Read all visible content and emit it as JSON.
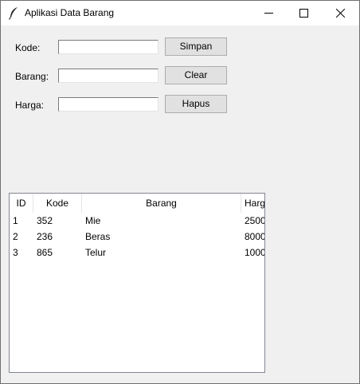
{
  "window": {
    "title": "Aplikasi Data Barang",
    "app_icon": "feather-icon",
    "controls": [
      "minimize-icon",
      "maximize-icon",
      "close-icon"
    ]
  },
  "form": {
    "kode_label": "Kode:",
    "barang_label": "Barang:",
    "harga_label": "Harga:",
    "kode_value": "",
    "barang_value": "",
    "harga_value": ""
  },
  "buttons": {
    "simpan": "Simpan",
    "clear": "Clear",
    "hapus": "Hapus"
  },
  "table": {
    "columns": [
      "ID",
      "Kode",
      "Barang",
      "Harg"
    ],
    "rows": [
      {
        "id": "1",
        "kode": "352",
        "barang": "Mie",
        "harga": "2500"
      },
      {
        "id": "2",
        "kode": "236",
        "barang": "Beras",
        "harga": "8000"
      },
      {
        "id": "3",
        "kode": "865",
        "barang": "Telur",
        "harga": "1000"
      }
    ]
  }
}
